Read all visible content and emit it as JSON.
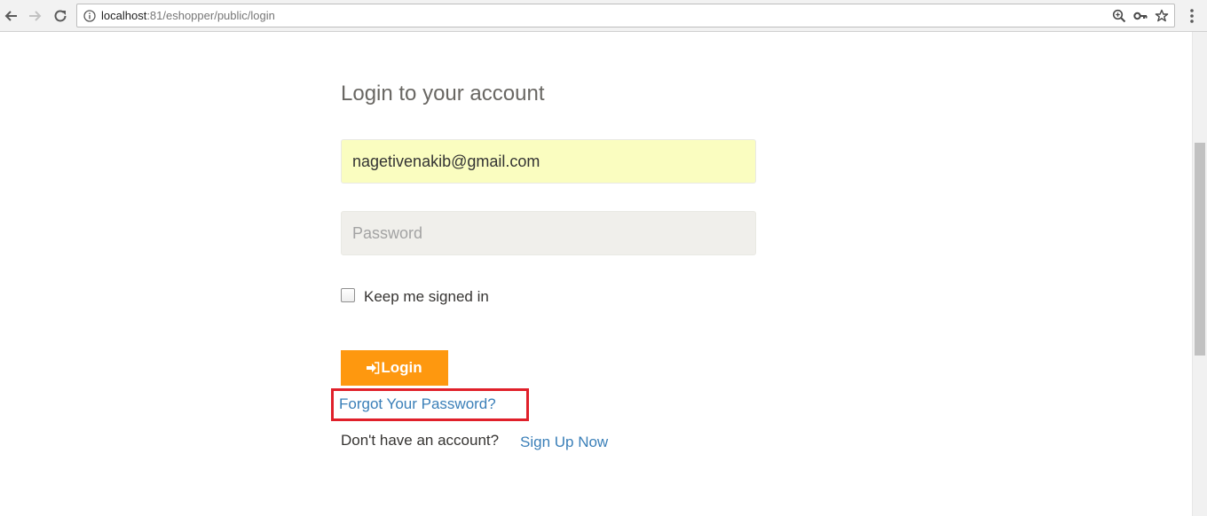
{
  "browser": {
    "url_host": "localhost",
    "url_rest": ":81/eshopper/public/login",
    "icons": [
      "back-arrow-icon",
      "forward-arrow-icon",
      "reload-icon",
      "info-icon",
      "zoom-icon",
      "key-icon",
      "star-icon",
      "menu-dots-icon"
    ]
  },
  "login": {
    "title": "Login to your account",
    "email_value": "nagetivenakib@gmail.com",
    "password_placeholder": "Password",
    "remember_label": "Keep me signed in",
    "button_label": "Login",
    "forgot_label": "Forgot Your Password?",
    "no_account_text": "Don't have an account?",
    "signup_label": "Sign Up Now"
  },
  "colors": {
    "accent": "#fe980f",
    "link": "#3a7fb8",
    "highlight": "#e0202a",
    "autofill": "#fafdc0"
  }
}
